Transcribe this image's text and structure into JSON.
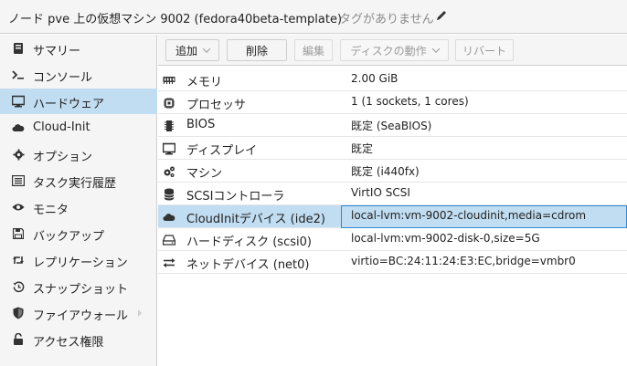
{
  "header": {
    "title": "ノード pve 上の仮想マシン 9002 (fedora40beta-template)",
    "tags_placeholder": "タグがありません"
  },
  "sidebar": {
    "items": [
      {
        "label": "サマリー",
        "icon": "book-icon"
      },
      {
        "label": "コンソール",
        "icon": "terminal-icon"
      },
      {
        "label": "ハードウェア",
        "icon": "desktop-icon",
        "active": true
      },
      {
        "label": "Cloud-Init",
        "icon": "cloud-icon"
      },
      {
        "label": "オプション",
        "icon": "gear-icon"
      },
      {
        "label": "タスク実行履歴",
        "icon": "list-icon"
      },
      {
        "label": "モニタ",
        "icon": "eye-icon"
      },
      {
        "label": "バックアップ",
        "icon": "floppy-icon"
      },
      {
        "label": "レプリケーション",
        "icon": "retweet-icon"
      },
      {
        "label": "スナップショット",
        "icon": "history-icon"
      },
      {
        "label": "ファイアウォール",
        "icon": "shield-icon"
      },
      {
        "label": "アクセス権限",
        "icon": "unlock-icon"
      }
    ]
  },
  "toolbar": {
    "add_label": "追加",
    "delete_label": "削除",
    "edit_label": "編集",
    "disk_action_label": "ディスクの動作",
    "revert_label": "リバート"
  },
  "hardware": {
    "rows": [
      {
        "key": "メモリ",
        "value": "2.00 GiB",
        "icon": "memory-icon"
      },
      {
        "key": "プロセッサ",
        "value": "1 (1 sockets, 1 cores)",
        "icon": "cpu-icon"
      },
      {
        "key": "BIOS",
        "value": "既定 (SeaBIOS)",
        "icon": "microchip-icon"
      },
      {
        "key": "ディスプレイ",
        "value": "既定",
        "icon": "desktop-icon"
      },
      {
        "key": "マシン",
        "value": "既定 (i440fx)",
        "icon": "cogs-icon"
      },
      {
        "key": "SCSIコントローラ",
        "value": "VirtIO SCSI",
        "icon": "database-icon"
      },
      {
        "key": "CloudInitデバイス (ide2)",
        "value": "local-lvm:vm-9002-cloudinit,media=cdrom",
        "icon": "cloud-icon",
        "selected": true
      },
      {
        "key": "ハードディスク (scsi0)",
        "value": "local-lvm:vm-9002-disk-0,size=5G",
        "icon": "hdd-icon"
      },
      {
        "key": "ネットデバイス (net0)",
        "value": "virtio=BC:24:11:24:E3:EC,bridge=vmbr0",
        "icon": "exchange-icon"
      }
    ]
  },
  "colors": {
    "accent_selected": "#c1ddf1",
    "selection_border": "#2e8ad8"
  }
}
